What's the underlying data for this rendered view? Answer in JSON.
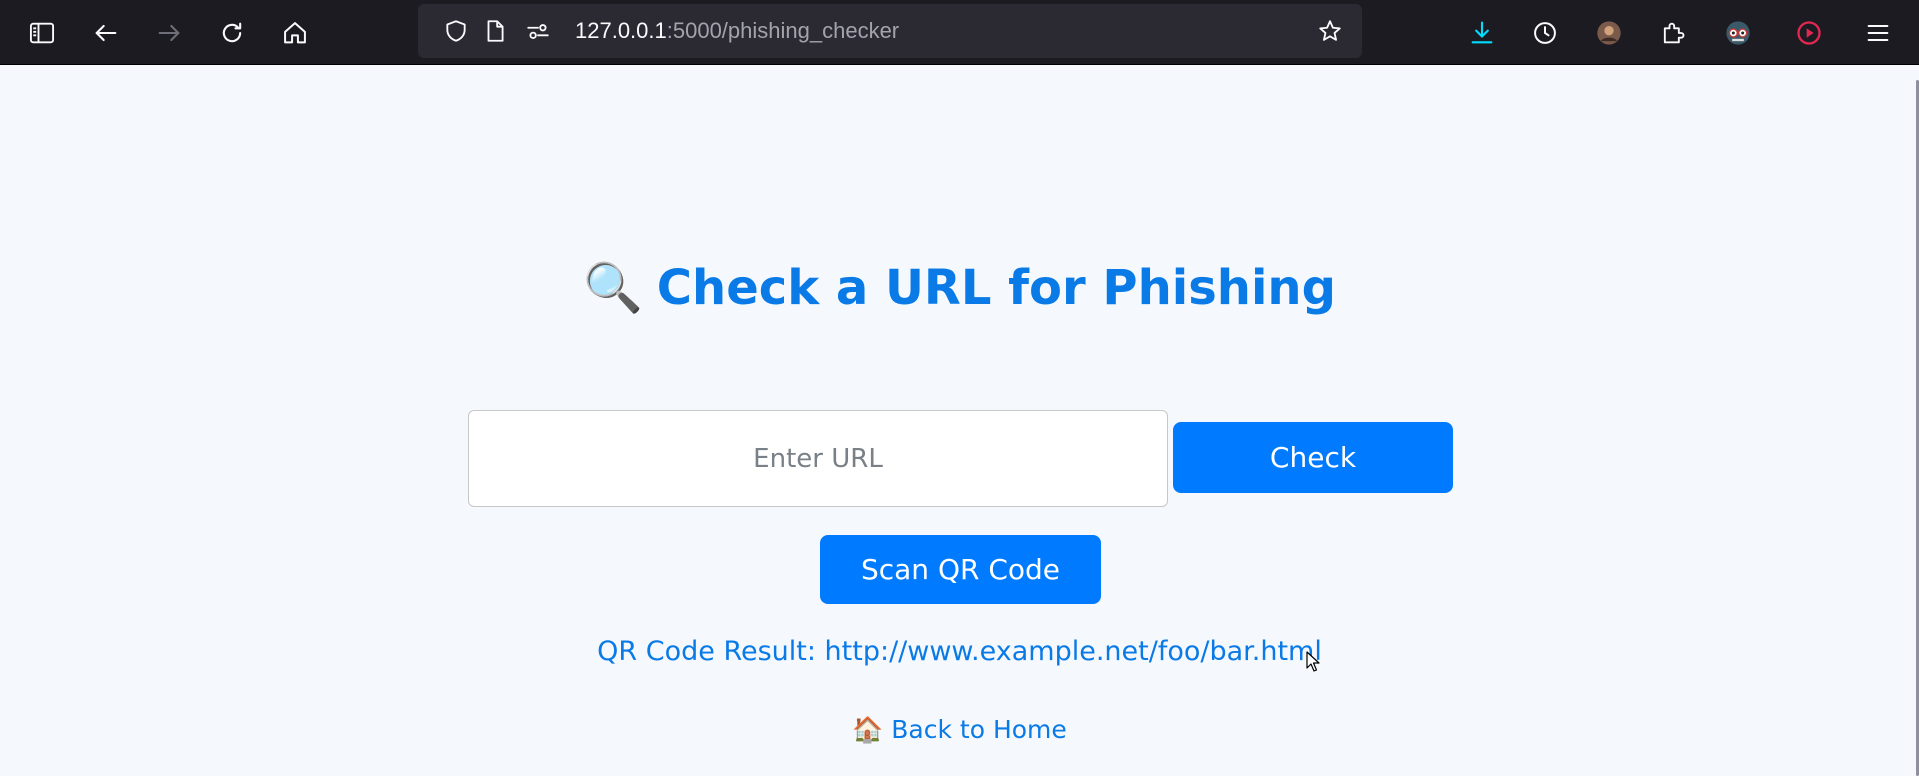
{
  "browser": {
    "url_host": "127.0.0.1",
    "url_path": ":5000/phishing_checker",
    "icons": {
      "sidebar": "sidebar-icon",
      "back": "back-arrow-icon",
      "forward": "forward-arrow-icon",
      "reload": "reload-icon",
      "home": "home-icon",
      "shield": "tracking-protection-shield-icon",
      "page": "page-info-icon",
      "permissions": "permissions-icon",
      "bookmark": "star-icon",
      "downloads": "download-icon",
      "history": "clock-icon",
      "account": "avatar",
      "extensions": "puzzle-icon",
      "extension_glasses": "glasses-extension-icon",
      "extension_record": "record-extension-icon",
      "menu": "hamburger-menu-icon"
    },
    "colors": {
      "toolbar_bg": "#1c1b22",
      "urlbar_bg": "#2b2a33",
      "download_accent": "#00ddff",
      "record_accent": "#e22850"
    }
  },
  "page": {
    "heading_emoji": "🔍",
    "heading_text": "Check a URL for Phishing",
    "url_input_placeholder": "Enter URL",
    "url_input_value": "",
    "check_button": "Check",
    "scan_qr_button": "Scan QR Code",
    "qr_result_text": "QR Code Result: http://www.example.net/foo/bar.html",
    "back_home_emoji": "🏠",
    "back_home_text": "Back to Home",
    "colors": {
      "accent": "#007bff",
      "heading": "#0a7ae6",
      "background": "#f5f9fd"
    }
  }
}
